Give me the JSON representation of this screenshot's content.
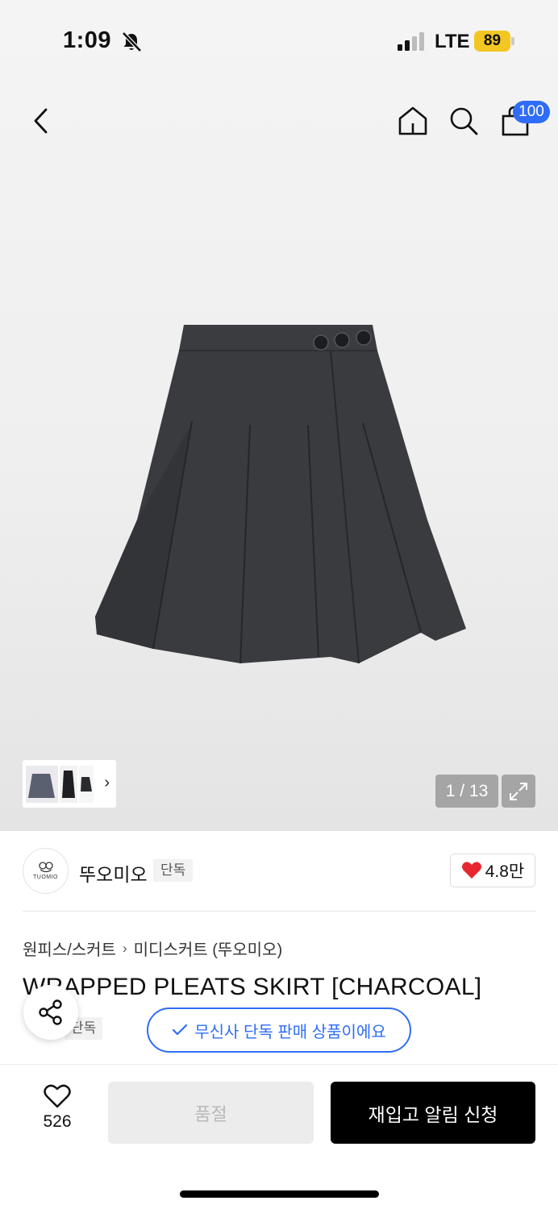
{
  "status_bar": {
    "time": "1:09",
    "network": "LTE",
    "battery": "89"
  },
  "header": {
    "cart_count": "100"
  },
  "gallery": {
    "counter": "1 / 13",
    "thumbnails_arrow": "›"
  },
  "brand": {
    "name": "뚜오미오",
    "logo_text": "TUOMIO",
    "tag": "단독",
    "likes": "4.8만"
  },
  "breadcrumb": {
    "category": "원피스/스커트",
    "separator": "›",
    "subcategory": "미디스커트 (뚜오미오)"
  },
  "product": {
    "title": "WRAPPED PLEATS SKIRT [CHARCOAL]",
    "tag": "단독",
    "exclusive_notice": "무신사 단독 판매 상품이에요"
  },
  "bottom_bar": {
    "wish_count": "526",
    "soldout_label": "품절",
    "restock_label": "재입고 알림 신청"
  },
  "colors": {
    "accent_blue": "#2f6df6",
    "battery_yellow": "#f3c622",
    "heart_red": "#e8262f"
  }
}
